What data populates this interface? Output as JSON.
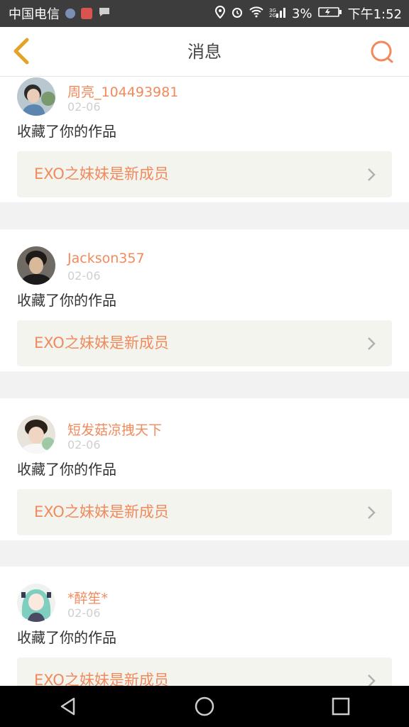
{
  "status_bar": {
    "carrier": "中国电信",
    "battery": "3%",
    "time": "下午1:52"
  },
  "header": {
    "title": "消息"
  },
  "messages": [
    {
      "username": "周亮_104493981",
      "date": "02-06",
      "action": "收藏了你的作品",
      "work_title": "EXO之妹妹是新成员"
    },
    {
      "username": "Jackson357",
      "date": "02-06",
      "action": "收藏了你的作品",
      "work_title": "EXO之妹妹是新成员"
    },
    {
      "username": "短发菇凉拽天下",
      "date": "02-06",
      "action": "收藏了你的作品",
      "work_title": "EXO之妹妹是新成员"
    },
    {
      "username": "*醉笙*",
      "date": "02-06",
      "action": "收藏了你的作品",
      "work_title": "EXO之妹妹是新成员"
    }
  ],
  "colors": {
    "accent": "#f08a5d",
    "back_arrow": "#e3a32b",
    "card_bg": "#f4f4ee"
  }
}
